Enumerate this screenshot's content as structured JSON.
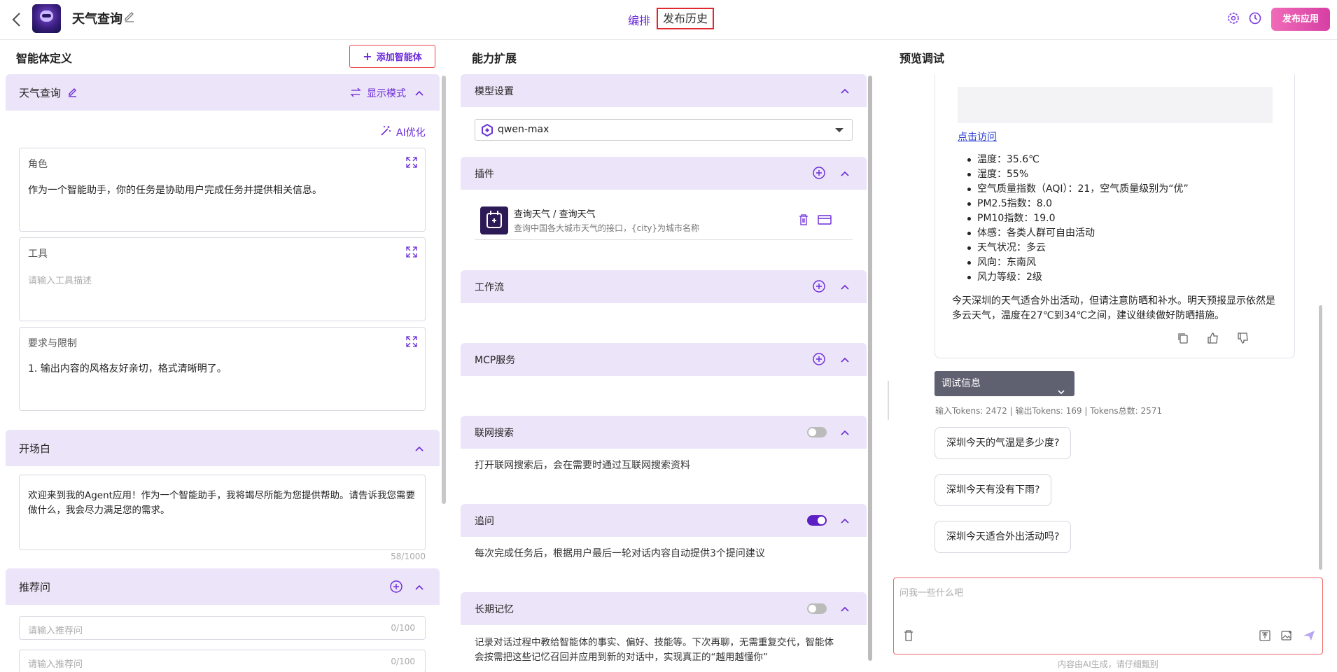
{
  "header": {
    "title": "天气查询",
    "tab_arrange": "编排",
    "tab_history": "发布历史",
    "publish_label": "发布应用"
  },
  "left": {
    "section_title": "智能体定义",
    "add_agent_label": "添加智能体",
    "agent_card": {
      "name": "天气查询",
      "display_mode": "显示模式",
      "ai_optimize": "AI优化",
      "role_label": "角色",
      "role_text": "作为一个智能助手，你的任务是协助用户完成任务并提供相关信息。",
      "tools_label": "工具",
      "tools_placeholder": "请输入工具描述",
      "req_label": "要求与限制",
      "req_text": "1. 输出内容的风格友好亲切，格式清晰明了。"
    },
    "opening": {
      "title": "开场白",
      "text": "欢迎来到我的Agent应用！作为一个智能助手，我将竭尽所能为您提供帮助。请告诉我您需要做什么，我会尽力满足您的需求。",
      "count": "58/1000"
    },
    "recommend": {
      "title": "推荐问",
      "placeholder1": "请输入推荐问",
      "count1": "0/100",
      "placeholder2": "请输入推荐问",
      "count2": "0/100"
    }
  },
  "middle": {
    "section_title": "能力扩展",
    "model": {
      "title": "模型设置",
      "value": "qwen-max"
    },
    "plugin": {
      "title": "插件",
      "name": "查询天气 / 查询天气",
      "desc": "查询中国各大城市天气的接口，{city}为城市名称"
    },
    "workflow": {
      "title": "工作流"
    },
    "mcp": {
      "title": "MCP服务"
    },
    "web_search": {
      "title": "联网搜索",
      "enabled": false,
      "desc": "打开联网搜索后，会在需要时通过互联网搜索资料"
    },
    "follow_up": {
      "title": "追问",
      "enabled": true,
      "desc": "每次完成任务后，根据用户最后一轮对话内容自动提供3个提问建议"
    },
    "memory": {
      "title": "长期记忆",
      "enabled": false,
      "desc1": "记录对话过程中教给智能体的事实、偏好、技能等。下次再聊，无需重复交代，智能体",
      "desc2": "会按需把这些记忆召回并应用到新的对话中，实现真正的“越用越懂你”"
    }
  },
  "right": {
    "section_title": "预览调试",
    "link_text": "点击访问",
    "weather": [
      "温度：35.6℃",
      "湿度：55%",
      "空气质量指数（AQI）：21，空气质量级别为“优”",
      "PM2.5指数：8.0",
      "PM10指数：19.0",
      "体感：各类人群可自由活动",
      "天气状况：多云",
      "风向：东南风",
      "风力等级：2级"
    ],
    "summary": "今天深圳的天气适合外出活动，但请注意防晒和补水。明天预报显示依然是多云天气，温度在27℃到34℃之间，建议继续做好防晒措施。",
    "debug_label": "调试信息",
    "tokens": "输入Tokens: 2472 |  输出Tokens: 169 |  Tokens总数: 2571",
    "suggestions": [
      "深圳今天的气温是多少度?",
      "深圳今天有没有下雨?",
      "深圳今天适合外出活动吗?"
    ],
    "input_placeholder": "问我一些什么吧",
    "footer": "内容由AI生成，请仔细甄别"
  },
  "colors": {
    "accent": "#6b2bd9",
    "header_bg": "#ece4f8",
    "publish": "#e052ab"
  }
}
